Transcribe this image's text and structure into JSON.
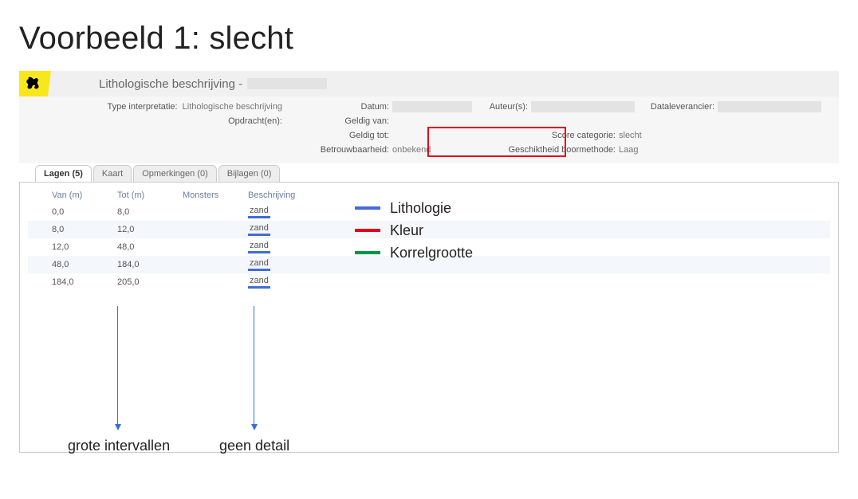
{
  "slide_title": "Voorbeeld 1: slecht",
  "header": {
    "app_title": "Lithologische beschrijving - "
  },
  "meta": {
    "type_lbl": "Type interpretatie:",
    "type_val": "Lithologische beschrijving",
    "opdracht_lbl": "Opdracht(en):",
    "opdracht_val": "",
    "datum_lbl": "Datum:",
    "auteur_lbl": "Auteur(s):",
    "datalev_lbl": "Dataleverancier:",
    "geldig_van_lbl": "Geldig van:",
    "geldig_tot_lbl": "Geldig tot:",
    "betrouw_lbl": "Betrouwbaarheid:",
    "betrouw_val": "onbekend",
    "score_lbl": "Score categorie:",
    "score_val": "slecht",
    "gesch_lbl": "Geschiktheid boormethode:",
    "gesch_val": "Laag"
  },
  "tabs": [
    {
      "id": "lagen",
      "label": "Lagen (5)",
      "active": true
    },
    {
      "id": "kaart",
      "label": "Kaart",
      "active": false
    },
    {
      "id": "opm",
      "label": "Opmerkingen (0)",
      "active": false
    },
    {
      "id": "bijl",
      "label": "Bijlagen (0)",
      "active": false
    }
  ],
  "table": {
    "headers": {
      "van": "Van (m)",
      "tot": "Tot (m)",
      "monsters": "Monsters",
      "beschrijving": "Beschrijving"
    },
    "rows": [
      {
        "van": "0,0",
        "tot": "8,0",
        "monsters": "",
        "beschrijving": "zand"
      },
      {
        "van": "8,0",
        "tot": "12,0",
        "monsters": "",
        "beschrijving": "zand"
      },
      {
        "van": "12,0",
        "tot": "48,0",
        "monsters": "",
        "beschrijving": "zand"
      },
      {
        "van": "48,0",
        "tot": "184,0",
        "monsters": "",
        "beschrijving": "zand"
      },
      {
        "van": "184,0",
        "tot": "205,0",
        "monsters": "",
        "beschrijving": "zand"
      }
    ]
  },
  "legend": {
    "lith": "Lithologie",
    "kleur": "Kleur",
    "korrel": "Korrelgrootte"
  },
  "annotations": {
    "interval": "grote intervallen",
    "detail": "geen detail"
  }
}
